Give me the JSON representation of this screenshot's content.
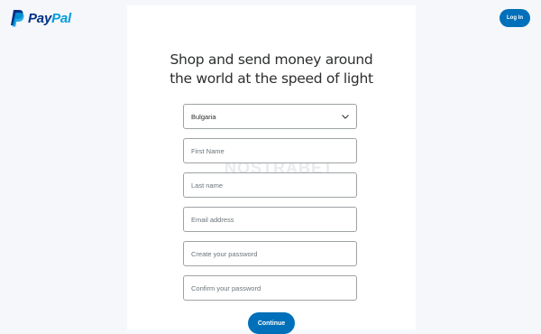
{
  "brand": {
    "name_part1": "Pay",
    "name_part2": "Pal",
    "colors": {
      "dark_blue": "#003087",
      "light_blue": "#009cde",
      "button_blue": "#0070ba"
    }
  },
  "header": {
    "login_label": "Log In"
  },
  "main": {
    "headline_line1": "Shop and send money around",
    "headline_line2": "the world at the speed of light",
    "watermark": "NOSTRABET",
    "country_select": {
      "value": "Bulgaria",
      "icon": "chevron-down-icon"
    },
    "fields": {
      "first_name": "First Name",
      "last_name": "Last name",
      "email": "Email address",
      "password": "Create your password",
      "confirm_password": "Confirm your password"
    },
    "continue_label": "Continue"
  }
}
